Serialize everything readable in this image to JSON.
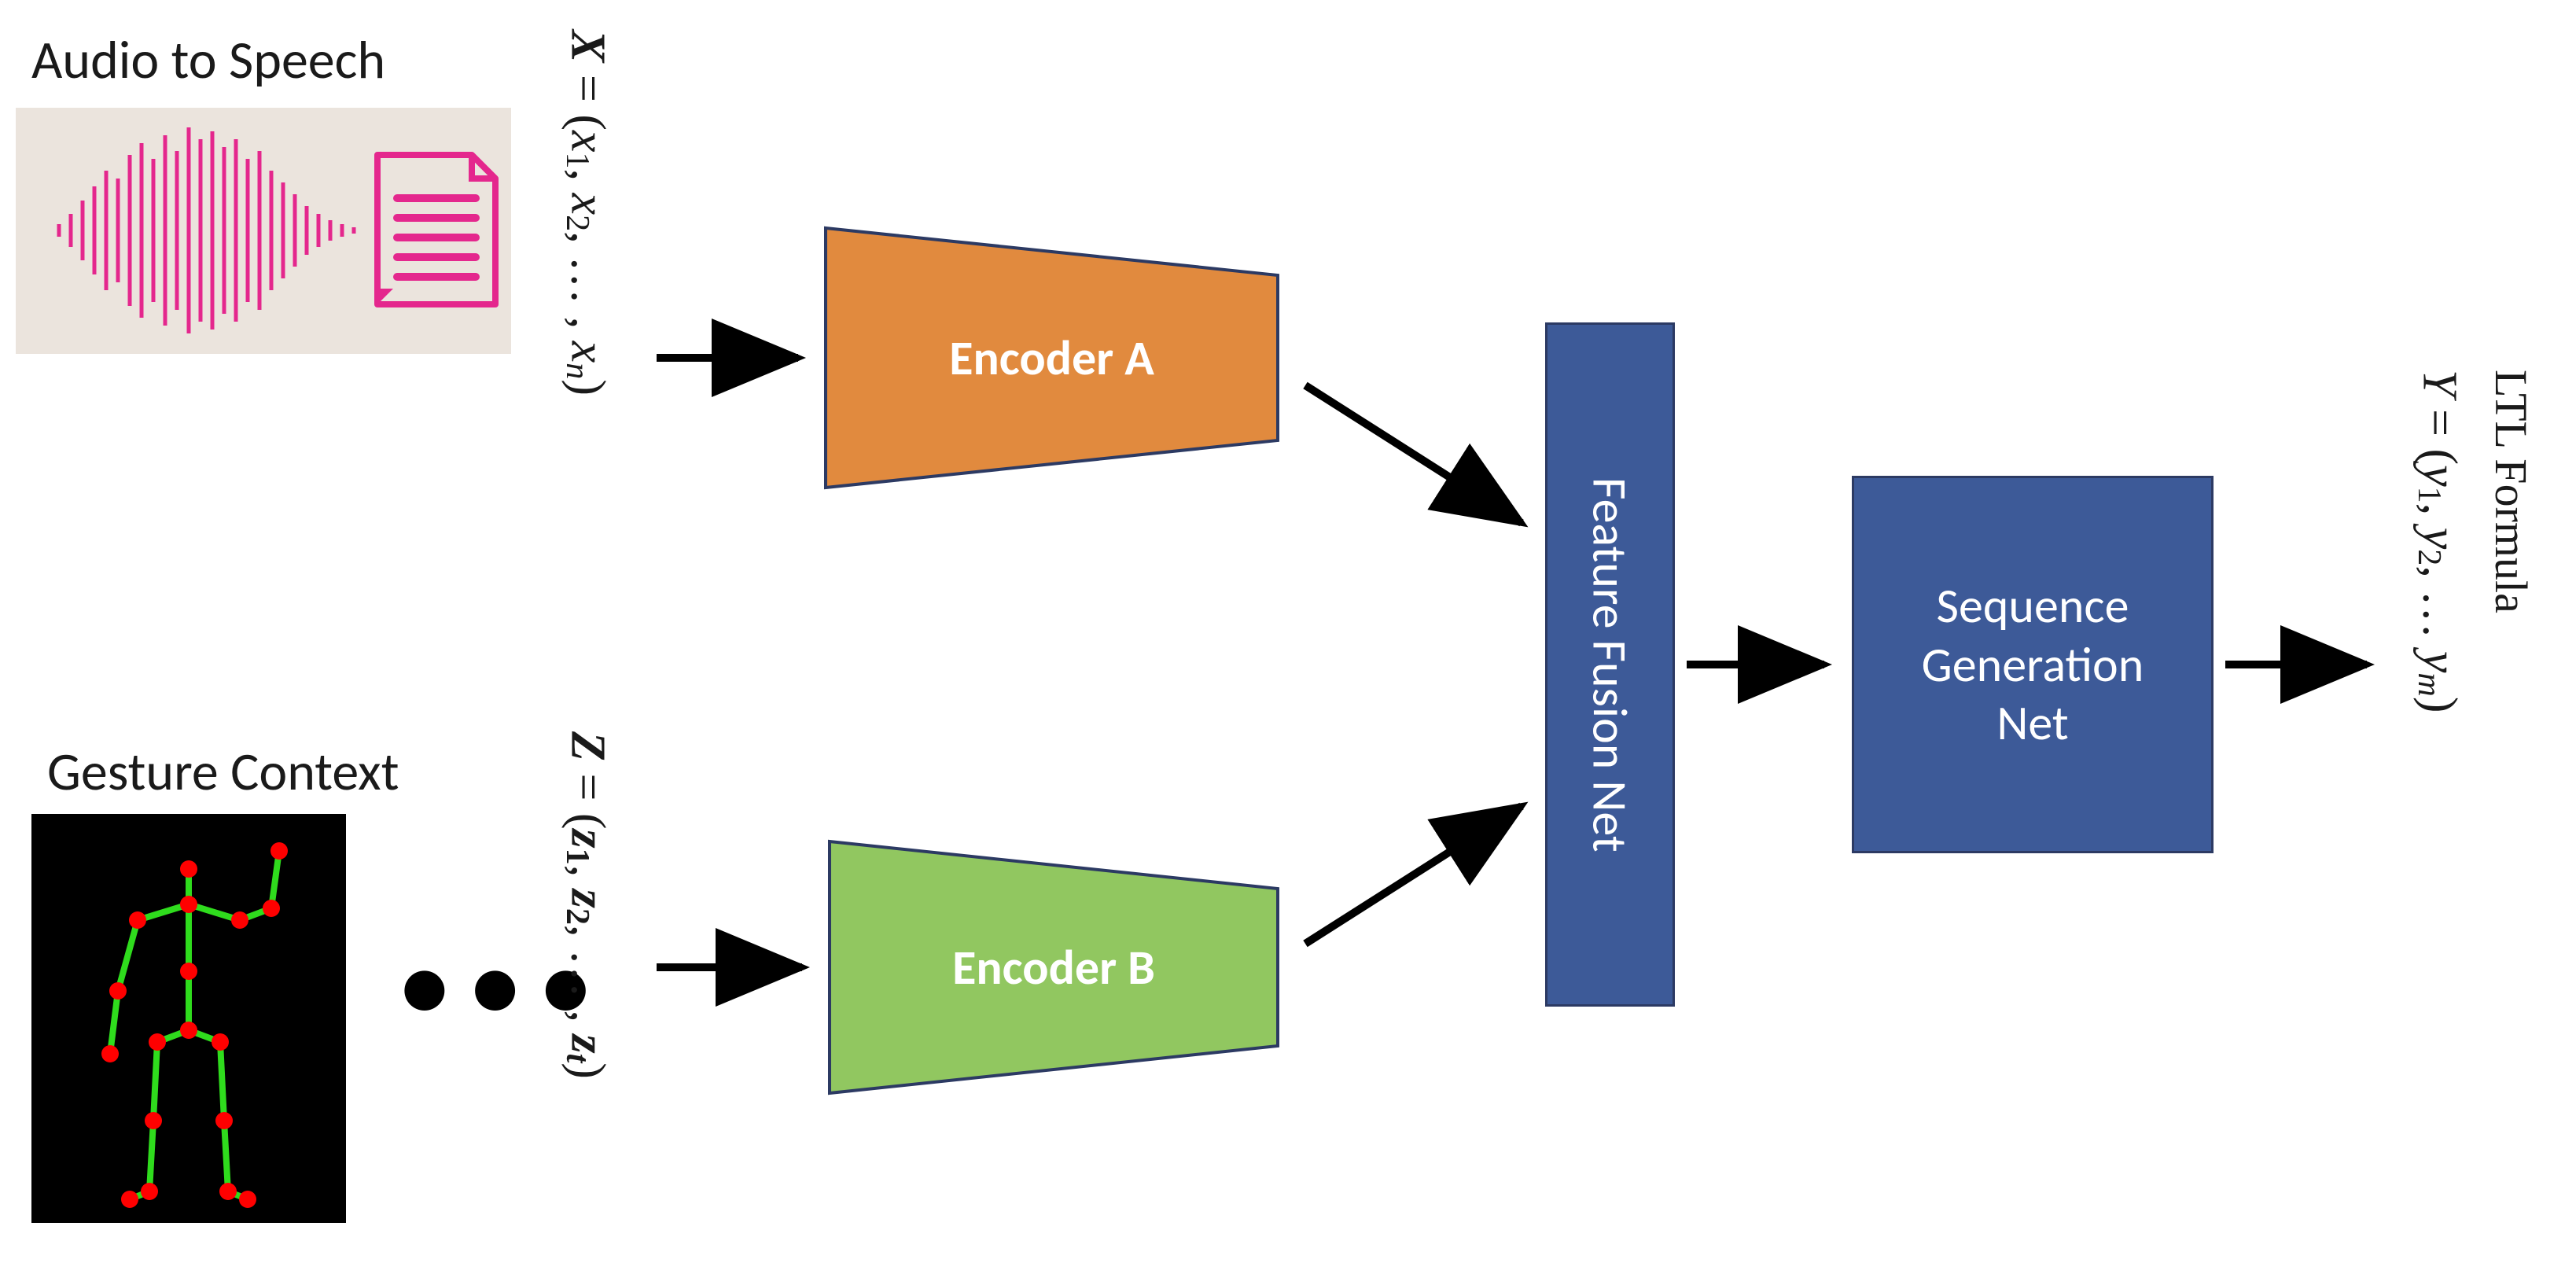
{
  "labels": {
    "audio_title": "Audio to Speech",
    "gesture_title": "Gesture Context",
    "output_title": "LTL Formula"
  },
  "sequences": {
    "x_var": "X",
    "x_seq": "x",
    "x_count": "n",
    "z_var": "Z",
    "z_seq": "z",
    "z_count": "t",
    "y_var": "Y",
    "y_seq": "y",
    "y_count": "m"
  },
  "blocks": {
    "encoderA": "Encoder A",
    "encoderB": "Encoder B",
    "fusion": "Feature Fusion Net",
    "seqgen_l1": "Sequence",
    "seqgen_l2": "Generation",
    "seqgen_l3": "Net"
  },
  "colors": {
    "encoderA_fill": "#e18a3e",
    "encoderB_fill": "#91c760",
    "fusion_fill": "#3d5a98",
    "seqgen_fill": "#3d5a98",
    "outline": "#2c3a63",
    "waveform": "#e4278d",
    "skeleton_line": "#2fdc1d",
    "skeleton_joint": "#ff0000"
  }
}
